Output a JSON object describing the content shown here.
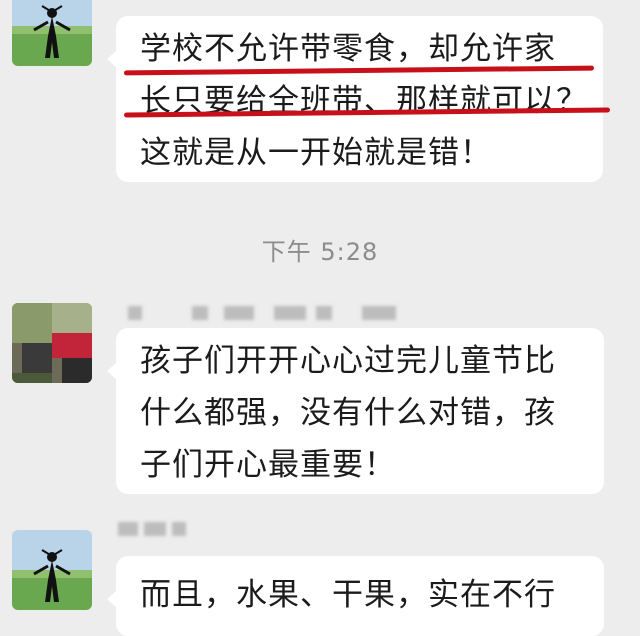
{
  "messages": [
    {
      "lines": [
        "学校不允许带零食，却允许家",
        "长只要给全班带、那样就可以？",
        "这就是从一开始就是错！"
      ]
    },
    {
      "lines": [
        "孩子们开开心心过完儿童节比",
        "什么都强，没有什么对错，孩",
        "子们开心最重要！"
      ]
    },
    {
      "lines": [
        "而且，水果、干果，实在不行"
      ]
    }
  ],
  "timestamp": "下午 5:28",
  "colors": {
    "background": "#ededed",
    "bubble": "#ffffff",
    "underline": "#c8101a",
    "timestamp": "#8c8c8c"
  }
}
